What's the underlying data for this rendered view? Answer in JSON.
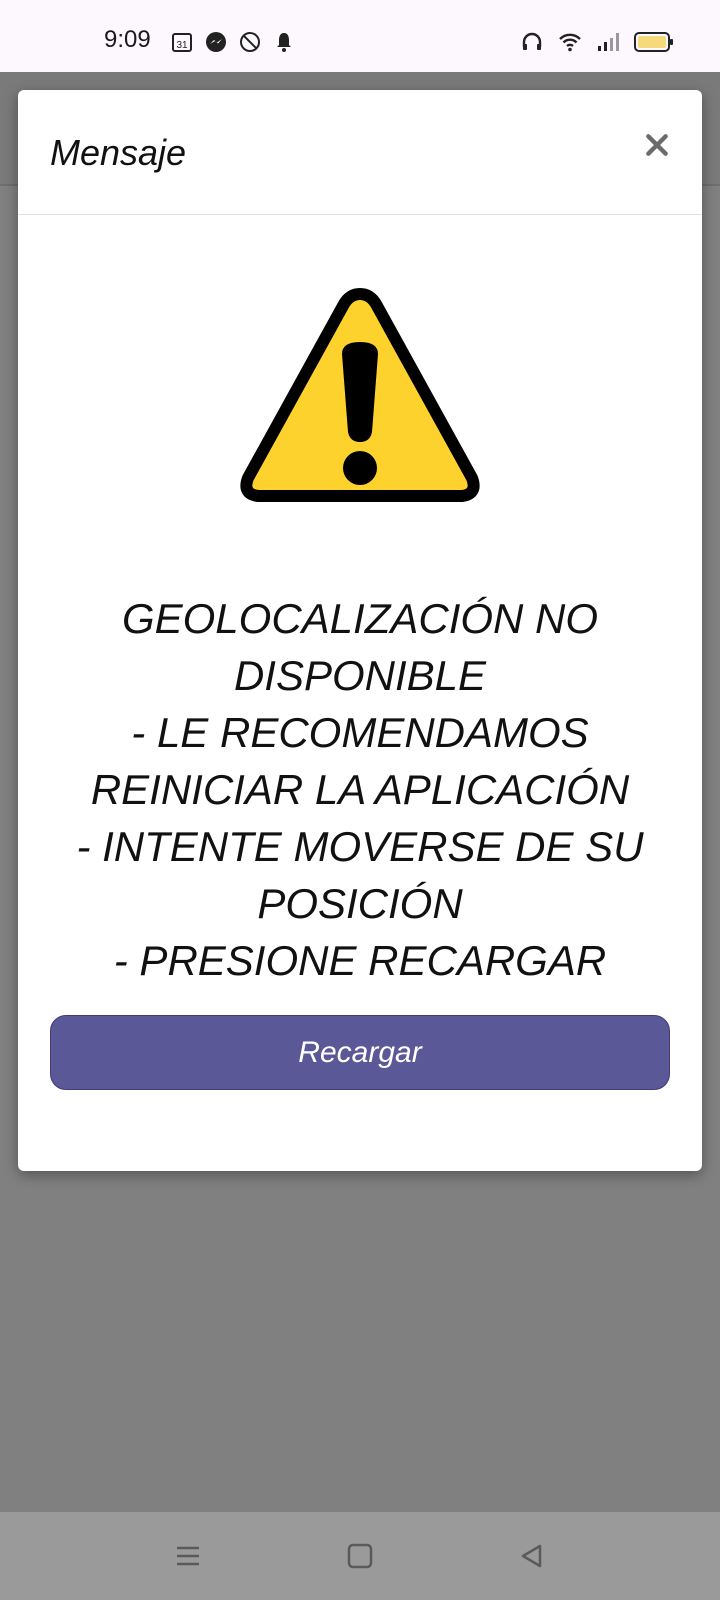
{
  "status_bar": {
    "time": "9:09",
    "calendar_day": "31",
    "left_icons": [
      "calendar-icon",
      "messenger-icon",
      "do-not-disturb-icon",
      "notification-bell-icon"
    ],
    "right_icons": [
      "headphones-icon",
      "wifi-icon",
      "cell-signal-icon",
      "battery-icon"
    ],
    "battery_color": "#f5d97a"
  },
  "modal": {
    "title": "Mensaje",
    "close_icon": "close-icon",
    "warning_icon": "warning-triangle-icon",
    "warning_color": "#fdd22d",
    "message": "GEOLOCALIZACIÓN NO DISPONIBLE\n- LE RECOMENDAMOS REINICIAR LA APLICACIÓN\n- INTENTE MOVERSE DE SU POSICIÓN\n- PRESIONE RECARGAR",
    "reload_label": "Recargar",
    "reload_color": "#5b5898"
  },
  "nav_bar": {
    "icons": [
      "menu-icon",
      "home-icon",
      "back-icon"
    ]
  }
}
